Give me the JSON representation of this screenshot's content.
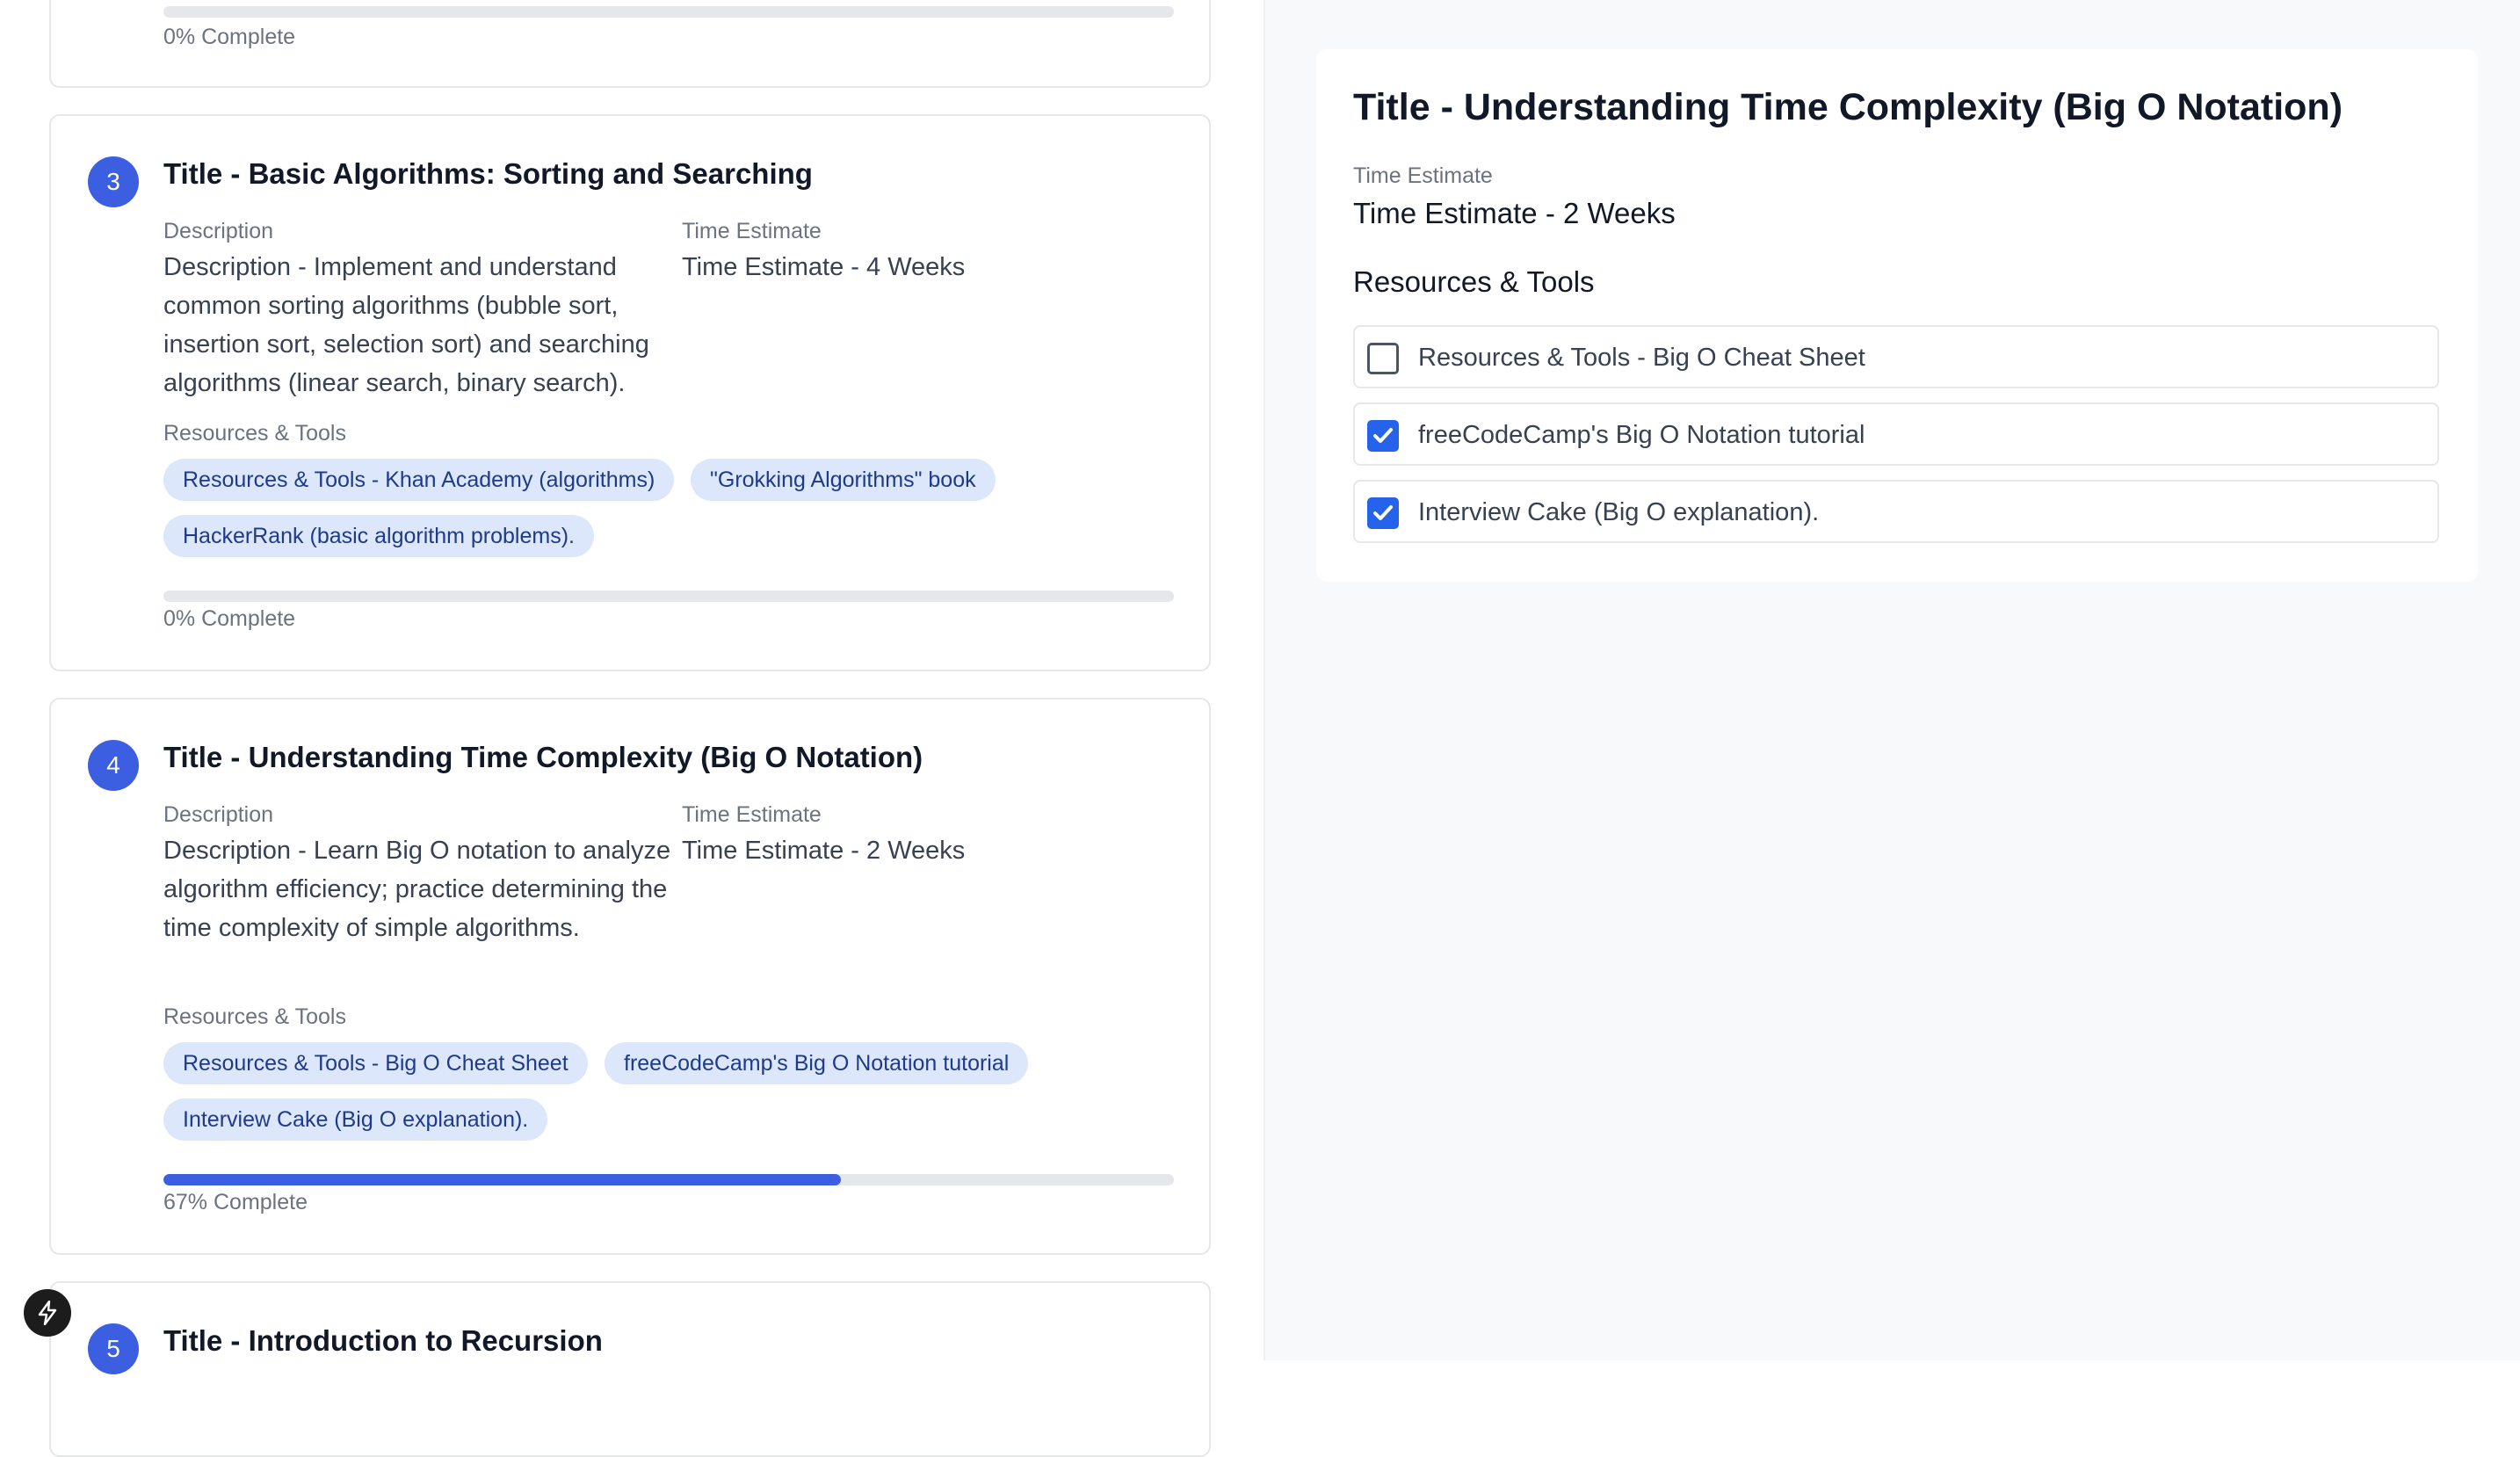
{
  "colors": {
    "accent": "#3b5fe0",
    "pill_bg": "#dce7fc",
    "pill_text": "#1e3a8a",
    "checkbox": "#2563eb"
  },
  "top_card": {
    "progress_text": "0% Complete",
    "progress": 0
  },
  "steps": [
    {
      "number": "3",
      "title": "Title - Basic Algorithms: Sorting and Searching",
      "description_label": "Description",
      "description": "Description - Implement and understand common sorting algorithms (bubble sort, insertion sort, selection sort) and searching algorithms (linear search, binary search).",
      "time_label": "Time Estimate",
      "time": "Time Estimate - 4 Weeks",
      "resources_label": "Resources & Tools",
      "resources": [
        "Resources & Tools - Khan Academy (algorithms)",
        "\"Grokking Algorithms\" book",
        "HackerRank (basic algorithm problems)."
      ],
      "progress": 0,
      "progress_text": "0% Complete"
    },
    {
      "number": "4",
      "title": "Title - Understanding Time Complexity (Big O Notation)",
      "description_label": "Description",
      "description": "Description - Learn Big O notation to analyze algorithm efficiency; practice determining the time complexity of simple algorithms.",
      "time_label": "Time Estimate",
      "time": "Time Estimate - 2 Weeks",
      "resources_label": "Resources & Tools",
      "resources": [
        "Resources & Tools - Big O Cheat Sheet",
        "freeCodeCamp's Big O Notation tutorial",
        "Interview Cake (Big O explanation)."
      ],
      "progress": 0.67,
      "progress_text": "67% Complete"
    },
    {
      "number": "5",
      "title": "Title - Introduction to Recursion"
    }
  ],
  "detail": {
    "title": "Title - Understanding Time Complexity (Big O Notation)",
    "time_label": "Time Estimate",
    "time": "Time Estimate - 2 Weeks",
    "resources_label": "Resources & Tools",
    "resources": [
      {
        "label": "Resources & Tools - Big O Cheat Sheet",
        "checked": false
      },
      {
        "label": "freeCodeCamp's Big O Notation tutorial",
        "checked": true
      },
      {
        "label": "Interview Cake (Big O explanation).",
        "checked": true
      }
    ]
  },
  "float_button": {
    "icon": "lightning-bolt-icon"
  }
}
